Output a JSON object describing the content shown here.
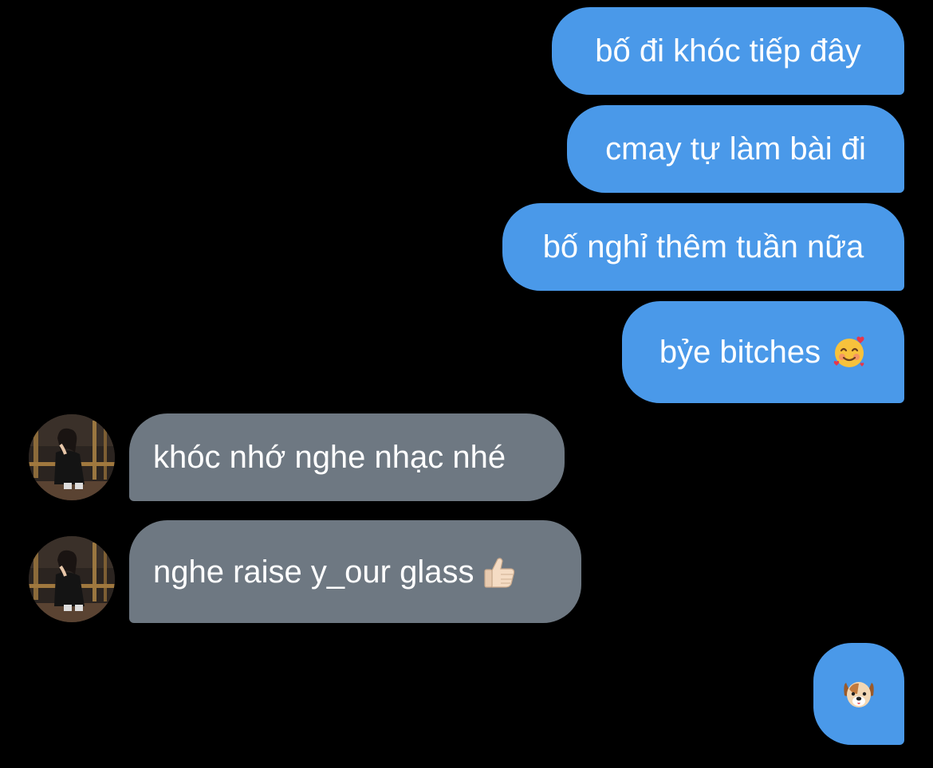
{
  "conversation": {
    "messages": [
      {
        "sender": "me",
        "text": "bố đi khóc tiếp đây"
      },
      {
        "sender": "me",
        "text": "cmay tự làm bài đi"
      },
      {
        "sender": "me",
        "text": "bố nghỉ thêm tuần nữa"
      },
      {
        "sender": "me",
        "text": "bỷe bitches",
        "emoji": "smiling-face-with-hearts-icon"
      },
      {
        "sender": "other",
        "text": "khóc nhớ nghe nhạc nhé"
      },
      {
        "sender": "other",
        "text": "nghe raise y_our glass",
        "emoji": "thumbs-up-icon"
      },
      {
        "sender": "me",
        "text": "",
        "emoji": "dog-face-icon"
      }
    ]
  },
  "colors": {
    "background": "#000000",
    "outgoing_bubble": "#4a99e9",
    "incoming_bubble": "#6e7882",
    "text": "#ffffff"
  }
}
